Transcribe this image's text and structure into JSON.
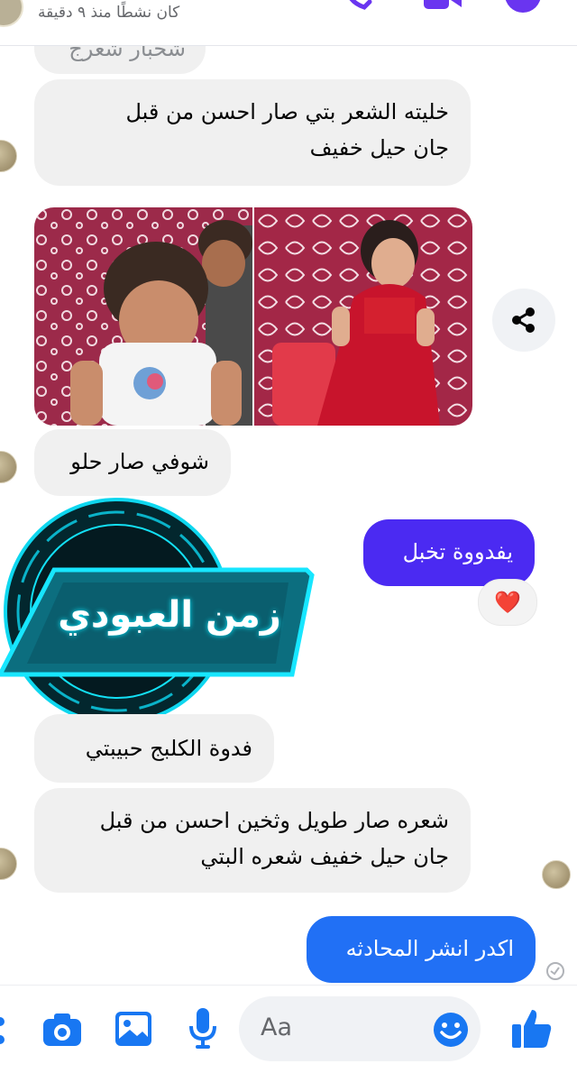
{
  "header": {
    "status_text": "كان نشطًا منذ ٩ دقيقة",
    "icons": [
      "phone-icon",
      "video-icon",
      "info-icon"
    ]
  },
  "messages": [
    {
      "id": "m0",
      "type": "incoming",
      "text": "شحبار شعرج"
    },
    {
      "id": "m1",
      "type": "incoming",
      "lines": [
        "خليته الشعر بتي صار احسن من قبل",
        "جان حيل خفيف"
      ]
    },
    {
      "id": "m2",
      "type": "incoming",
      "text": "شوفي صار حلو"
    },
    {
      "id": "m3",
      "type": "outgoing",
      "text": "يفدووة تخبل",
      "reaction": "❤️"
    },
    {
      "id": "m4",
      "type": "incoming",
      "text": "فدوة الكلبج حبيبتي"
    },
    {
      "id": "m5",
      "type": "incoming",
      "lines": [
        "شعره صار طويل وثخين احسن من قبل",
        "جان حيل خفيف شعره البتي"
      ]
    },
    {
      "id": "m6",
      "type": "outgoing",
      "text": "اكدر انشر المحادثه"
    }
  ],
  "watermark": {
    "text": "زمن العبودي"
  },
  "composer": {
    "placeholder": "Aa",
    "icons": [
      "camera-icon",
      "image-icon",
      "microphone-icon",
      "emoji-icon",
      "like-icon"
    ]
  },
  "colors": {
    "outgoing_purple": "#4b2af2",
    "outgoing_blue": "#2170f5",
    "incoming_bg": "#f0f0f0",
    "icon_blue": "#1877f2",
    "header_icon_purple": "#6a35f0"
  }
}
